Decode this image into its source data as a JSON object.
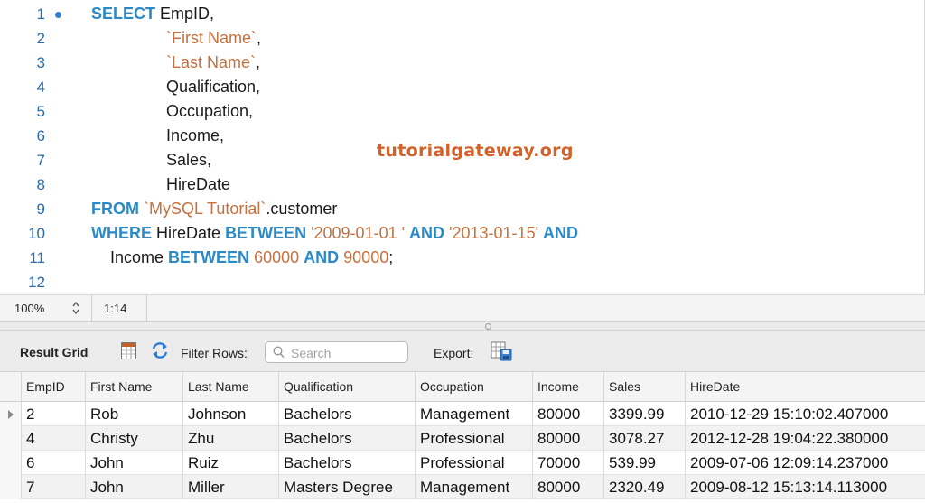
{
  "editor": {
    "line_numbers": [
      "1",
      "2",
      "3",
      "4",
      "5",
      "6",
      "7",
      "8",
      "9",
      "10",
      "11",
      "12"
    ],
    "watermark": "tutorialgateway.org",
    "tokens": {
      "select": "SELECT",
      "empid": "EmpID,",
      "first_name": "`First Name`",
      "last_name": "`Last Name`",
      "comma": ",",
      "qualification": "Qualification,",
      "occupation": "Occupation,",
      "income": "Income,",
      "sales": "Sales,",
      "hiredate": "HireDate",
      "from": "FROM",
      "schema": "`MySQL Tutorial`",
      "table": ".customer",
      "where": "WHERE",
      "hiredate_col": "HireDate",
      "between": "BETWEEN",
      "date1": "'2009-01-01 '",
      "and": "AND",
      "date2": "'2013-01-15'",
      "income_col": "Income",
      "num1": "60000",
      "num2": "90000",
      "semicolon": ";"
    }
  },
  "statusbar": {
    "zoom": "100%",
    "cursor": "1:14"
  },
  "toolbar": {
    "result_grid": "Result Grid",
    "filter_rows": "Filter Rows:",
    "search_placeholder": "Search",
    "export": "Export:"
  },
  "grid": {
    "columns": [
      "EmpID",
      "First Name",
      "Last Name",
      "Qualification",
      "Occupation",
      "Income",
      "Sales",
      "HireDate"
    ],
    "rows": [
      [
        "2",
        "Rob",
        "Johnson",
        "Bachelors",
        "Management",
        "80000",
        "3399.99",
        "2010-12-29 15:10:02.407000"
      ],
      [
        "4",
        "Christy",
        "Zhu",
        "Bachelors",
        "Professional",
        "80000",
        "3078.27",
        "2012-12-28 19:04:22.380000"
      ],
      [
        "6",
        "John",
        "Ruiz",
        "Bachelors",
        "Professional",
        "70000",
        "539.99",
        "2009-07-06 12:09:14.237000"
      ],
      [
        "7",
        "John",
        "Miller",
        "Masters Degree",
        "Management",
        "80000",
        "2320.49",
        "2009-08-12 15:13:14.113000"
      ]
    ]
  },
  "colors": {
    "keyword": "#2a8ac8",
    "string": "#c5703e",
    "watermark": "#d3622a",
    "line_number": "#2d6aa8"
  }
}
